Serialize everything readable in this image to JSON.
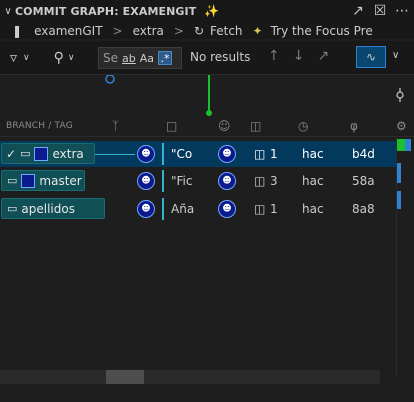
{
  "panel": {
    "title": "COMMIT GRAPH: EXAMENGIT",
    "header": {
      "repo": "examenGIT",
      "branch": "extra",
      "fetch_label": "Fetch",
      "promo": "Try the Focus Pre"
    },
    "toolbar": {
      "search_placeholder": "Se",
      "match_case": "ab",
      "whole_word": "Aa",
      "regex": ".*",
      "results": "No results"
    },
    "column_header": {
      "branch_tag": "BRANCH / TAG"
    },
    "rows": [
      {
        "branch": "extra",
        "checked": true,
        "message": "\"Co",
        "files": "1",
        "author": "hac",
        "sha": "b4d"
      },
      {
        "branch": "master",
        "checked": false,
        "message": "\"Fic",
        "files": "3",
        "author": "hac",
        "sha": "58a"
      },
      {
        "branch": "apellidos",
        "checked": false,
        "message": "Aña",
        "files": "1",
        "author": "hac",
        "sha": "8a8"
      }
    ],
    "colors": {
      "accent": "#2f82d4",
      "branch_pill": "#0f4f55",
      "graph_line": "#19c22c",
      "selection": "#04395e"
    }
  }
}
